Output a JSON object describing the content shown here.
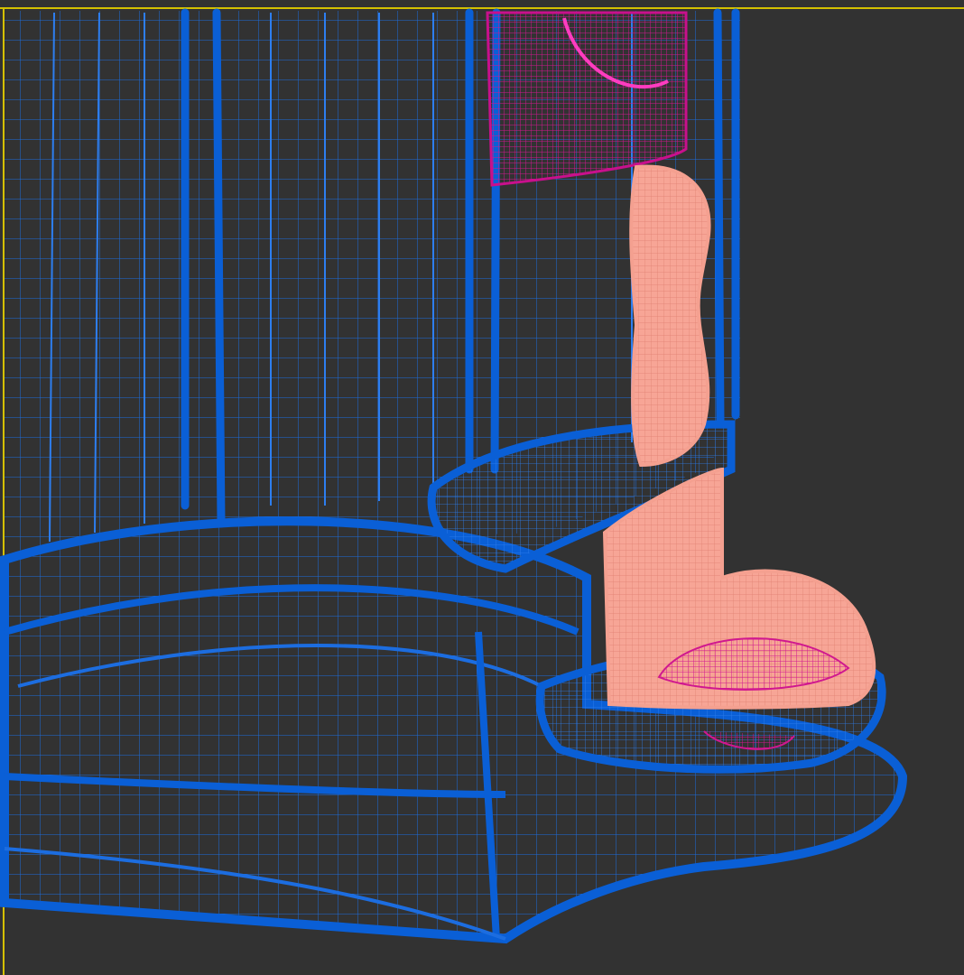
{
  "viewport": {
    "background": "#323232",
    "active_border_color": "#d4c000",
    "selected": true
  },
  "scene": {
    "model": "blue-wireframe-dispenser",
    "colors": {
      "body_wire": "#0a5fd6",
      "body_wire_light": "#2d7ef0",
      "spout_wire": "#f4a090",
      "spout_fill": "#ef9c8c",
      "panel_wire": "#c8108c",
      "panel_wire_light": "#ff3cc0"
    },
    "parts": [
      {
        "name": "main-body",
        "icon": "wireframe-body"
      },
      {
        "name": "top-panel",
        "icon": "wireframe-panel"
      },
      {
        "name": "spout-handle",
        "icon": "wireframe-handle"
      },
      {
        "name": "drip-tray",
        "icon": "wireframe-tray"
      },
      {
        "name": "base-platform",
        "icon": "wireframe-base"
      }
    ]
  }
}
